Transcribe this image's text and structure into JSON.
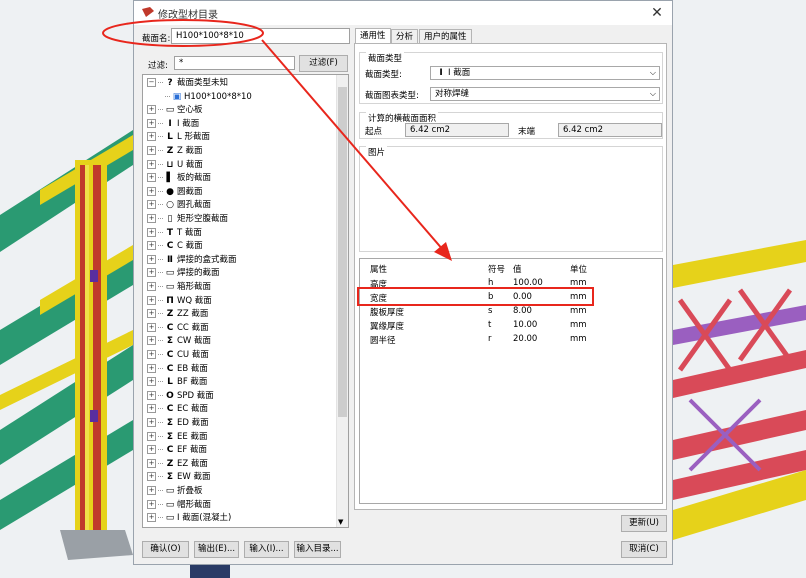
{
  "dialog": {
    "title": "修改型材目录",
    "close_glyph": "✕",
    "profile_name_label": "截面名:",
    "profile_name_value": "H100*100*8*10",
    "filter_label": "过滤:",
    "filter_value": "*",
    "filter_button": "过滤(F)"
  },
  "tree": {
    "items": [
      {
        "label": "截面类型未知",
        "glyph": "?",
        "expand": "⊟"
      },
      {
        "label": "H100*100*8*10",
        "glyph": "▣",
        "expand": ""
      },
      {
        "label": "空心板",
        "glyph": "▭",
        "expand": "⊞"
      },
      {
        "label": "I 截面",
        "glyph": "I",
        "expand": "⊞"
      },
      {
        "label": "L 形截面",
        "glyph": "L",
        "expand": "⊞"
      },
      {
        "label": "Z 截面",
        "glyph": "Z",
        "expand": "⊞"
      },
      {
        "label": "U 截面",
        "glyph": "⊔",
        "expand": "⊞"
      },
      {
        "label": "板的截面",
        "glyph": "▌",
        "expand": "⊞"
      },
      {
        "label": "圆截面",
        "glyph": "●",
        "expand": "⊞"
      },
      {
        "label": "圆孔截面",
        "glyph": "○",
        "expand": "⊞"
      },
      {
        "label": "矩形空腹截面",
        "glyph": "▯",
        "expand": "⊞"
      },
      {
        "label": "T 截面",
        "glyph": "T",
        "expand": "⊞"
      },
      {
        "label": "C 截面",
        "glyph": "C",
        "expand": "⊞"
      },
      {
        "label": "焊接的盒式截面",
        "glyph": "Ⅱ",
        "expand": "⊞"
      },
      {
        "label": "焊接的截面",
        "glyph": "▭",
        "expand": "⊞"
      },
      {
        "label": "箱形截面",
        "glyph": "▭",
        "expand": "⊞"
      },
      {
        "label": "WQ 截面",
        "glyph": "Π",
        "expand": "⊞"
      },
      {
        "label": "ZZ 截面",
        "glyph": "Z",
        "expand": "⊞"
      },
      {
        "label": "CC 截面",
        "glyph": "C",
        "expand": "⊞"
      },
      {
        "label": "CW 截面",
        "glyph": "Σ",
        "expand": "⊞"
      },
      {
        "label": "CU 截面",
        "glyph": "C",
        "expand": "⊞"
      },
      {
        "label": "EB 截面",
        "glyph": "C",
        "expand": "⊞"
      },
      {
        "label": "BF 截面",
        "glyph": "L",
        "expand": "⊞"
      },
      {
        "label": "SPD 截面",
        "glyph": "O",
        "expand": "⊞"
      },
      {
        "label": "EC 截面",
        "glyph": "C",
        "expand": "⊞"
      },
      {
        "label": "ED 截面",
        "glyph": "Σ",
        "expand": "⊞"
      },
      {
        "label": "EE 截面",
        "glyph": "Σ",
        "expand": "⊞"
      },
      {
        "label": "EF 截面",
        "glyph": "C",
        "expand": "⊞"
      },
      {
        "label": "EZ 截面",
        "glyph": "Z",
        "expand": "⊞"
      },
      {
        "label": "EW 截面",
        "glyph": "Σ",
        "expand": "⊞"
      },
      {
        "label": "折叠板",
        "glyph": "▭",
        "expand": "⊞"
      },
      {
        "label": "帽形截面",
        "glyph": "▭",
        "expand": "⊞"
      },
      {
        "label": "I 截面(混凝土)",
        "glyph": "▭",
        "expand": "⊞"
      }
    ]
  },
  "tabs": [
    {
      "label": "通用性",
      "active": true
    },
    {
      "label": "分析",
      "active": false
    },
    {
      "label": "用户的属性",
      "active": false
    }
  ],
  "section_type": {
    "group_title": "截面类型",
    "type_label": "截面类型:",
    "type_value": "I 截面",
    "sub_label": "截面图表类型:",
    "sub_value": "对称焊缝"
  },
  "area": {
    "group_title": "计算的横截面面积",
    "start_label": "起点",
    "start_value": "6.42 cm2",
    "end_label": "末端",
    "end_value": "6.42 cm2"
  },
  "picture": {
    "group_title": "图片"
  },
  "properties": {
    "headers": [
      "属性",
      "符号",
      "值",
      "单位"
    ],
    "rows": [
      {
        "name": "高度",
        "symbol": "h",
        "value": "100.00",
        "unit": "mm"
      },
      {
        "name": "宽度",
        "symbol": "b",
        "value": "0.00",
        "unit": "mm"
      },
      {
        "name": "腹板厚度",
        "symbol": "s",
        "value": "8.00",
        "unit": "mm"
      },
      {
        "name": "翼缘厚度",
        "symbol": "t",
        "value": "10.00",
        "unit": "mm"
      },
      {
        "name": "圆半径",
        "symbol": "r",
        "value": "20.00",
        "unit": "mm"
      }
    ]
  },
  "buttons": {
    "update": "更新(U)",
    "ok": "确认(O)",
    "export": "输出(E)...",
    "import": "输入(I)...",
    "import_catalog": "输入目录...",
    "cancel": "取消(C)"
  },
  "colors": {
    "annotation_red": "#e8261c",
    "beam_yellow": "#e6d21a",
    "beam_green": "#2a9a72",
    "beam_red": "#d94a58",
    "beam_purple": "#9a5fc0",
    "column_red": "#c0392b"
  }
}
